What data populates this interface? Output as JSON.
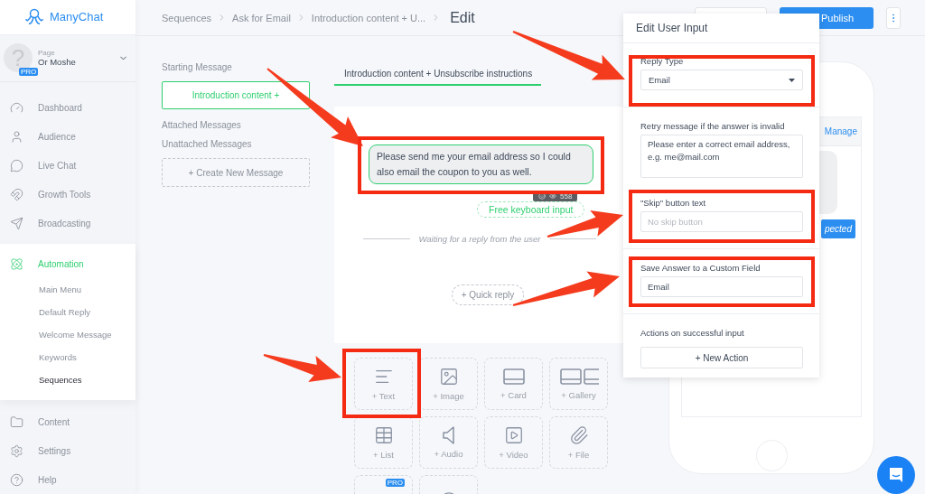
{
  "sidebar": {
    "brand": "ManyChat",
    "account": {
      "avatar": "?",
      "label": "Page",
      "name": "Or Moshe",
      "badge": "PRO"
    },
    "items": [
      {
        "label": "Dashboard",
        "selected": false
      },
      {
        "label": "Audience",
        "selected": false
      },
      {
        "label": "Live Chat",
        "selected": false
      },
      {
        "label": "Growth Tools",
        "selected": false
      },
      {
        "label": "Broadcasting",
        "selected": false
      },
      {
        "label": "Automation",
        "selected": true,
        "children": [
          {
            "label": "Main Menu",
            "selected": false
          },
          {
            "label": "Default Reply",
            "selected": false
          },
          {
            "label": "Welcome Message",
            "selected": false
          },
          {
            "label": "Keywords",
            "selected": false
          },
          {
            "label": "Sequences",
            "selected": true
          }
        ]
      },
      {
        "label": "Content",
        "selected": false
      },
      {
        "label": "Settings",
        "selected": false
      },
      {
        "label": "Help",
        "selected": false
      }
    ]
  },
  "header": {
    "breadcrumbs": [
      "Sequences",
      "Ask for Email",
      "Introduction content + U..."
    ],
    "current": "Edit",
    "publish": "Publish"
  },
  "sequence": {
    "starting_label": "Starting Message",
    "starting_button": "Introduction content +",
    "attached_label": "Attached Messages",
    "unattached_label": "Unattached Messages",
    "create_button": "+ Create New Message"
  },
  "editor": {
    "tab": {
      "label": "Introduction content + Unsubscribe instructions",
      "selected": true
    },
    "message": "Please send me your email address so I could also email the coupon to you as well.",
    "char_count": "558",
    "input_chip": "Free keyboard input",
    "waiting": "Waiting for a reply from the user",
    "quick_reply": "+ Quick reply"
  },
  "blocks": [
    {
      "kind": "text",
      "label": "+ Text"
    },
    {
      "kind": "image",
      "label": "+ Image"
    },
    {
      "kind": "card",
      "label": "+ Card"
    },
    {
      "kind": "gallery",
      "label": "+ Gallery"
    },
    {
      "kind": "list",
      "label": "+ List"
    },
    {
      "kind": "audio",
      "label": "+ Audio"
    },
    {
      "kind": "video",
      "label": "+ Video"
    },
    {
      "kind": "file",
      "label": "+ File"
    },
    {
      "kind": "pro",
      "badge": "PRO"
    },
    {
      "kind": "delay"
    }
  ],
  "panel": {
    "title": "Edit User Input",
    "reply_type": {
      "label": "Reply Type",
      "value": "Email"
    },
    "retry": {
      "label": "Retry message if the answer is invalid",
      "value": "Please enter a correct email address, e.g. me@mail.com"
    },
    "skip": {
      "label": "\"Skip\" button text",
      "placeholder": "No skip button"
    },
    "save": {
      "label": "Save Answer to a Custom Field",
      "value": "Email"
    },
    "actions": {
      "label": "Actions on successful input",
      "button": "+ New Action"
    }
  },
  "preview": {
    "tab": "Manage",
    "button": "pected"
  },
  "annotations": [
    {
      "kind": "arrow"
    },
    {
      "kind": "arrow"
    },
    {
      "kind": "arrow"
    },
    {
      "kind": "arrow"
    },
    {
      "kind": "arrow"
    },
    {
      "kind": "frame"
    },
    {
      "kind": "frame"
    },
    {
      "kind": "frame"
    },
    {
      "kind": "frame"
    },
    {
      "kind": "frame"
    }
  ]
}
